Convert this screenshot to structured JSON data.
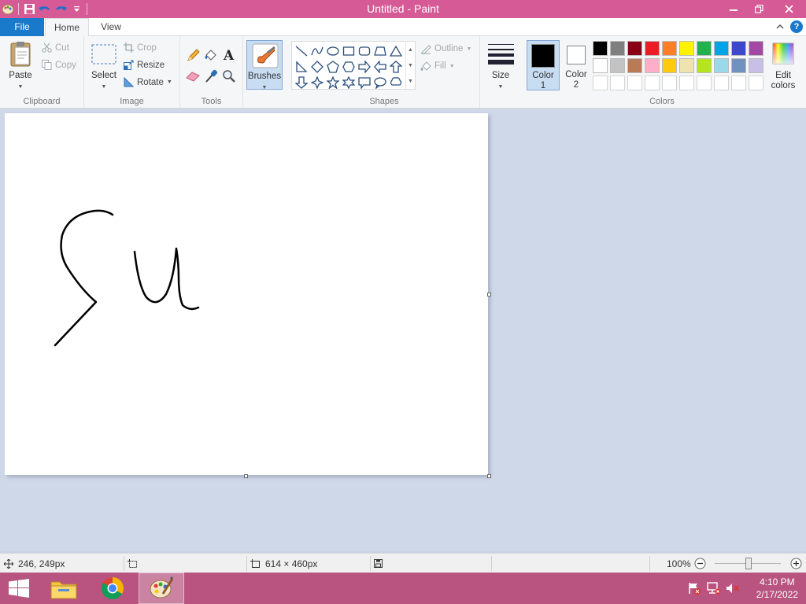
{
  "window": {
    "title": "Untitled - Paint"
  },
  "tabs": {
    "file": "File",
    "home": "Home",
    "view": "View"
  },
  "clipboard": {
    "group": "Clipboard",
    "paste": "Paste",
    "cut": "Cut",
    "copy": "Copy"
  },
  "image": {
    "group": "Image",
    "select": "Select",
    "crop": "Crop",
    "resize": "Resize",
    "rotate": "Rotate"
  },
  "tools": {
    "group": "Tools"
  },
  "brushes": {
    "label": "Brushes"
  },
  "shapes": {
    "group": "Shapes",
    "outline": "Outline",
    "fill": "Fill"
  },
  "size": {
    "label": "Size"
  },
  "colors": {
    "group": "Colors",
    "color1_line1": "Color",
    "color1_line2": "1",
    "color2_line1": "Color",
    "color2_line2": "2",
    "edit_line1": "Edit",
    "edit_line2": "colors",
    "color1": "#000000",
    "color2": "#ffffff",
    "palette_row1": [
      "#000000",
      "#7f7f7f",
      "#880015",
      "#ed1c24",
      "#ff7f27",
      "#fff200",
      "#22b14c",
      "#00a2e8",
      "#3f48cc",
      "#a349a4"
    ],
    "palette_row2": [
      "#ffffff",
      "#c3c3c3",
      "#b97a57",
      "#ffaec9",
      "#ffc90e",
      "#efe4b0",
      "#b5e61d",
      "#99d9ea",
      "#7092be",
      "#c8bfe7"
    ]
  },
  "status": {
    "cursor_pos": "246, 249px",
    "canvas_size": "614 × 460px",
    "zoom": "100%"
  },
  "taskbar": {
    "time": "4:10 PM",
    "date": "2/17/2022"
  }
}
